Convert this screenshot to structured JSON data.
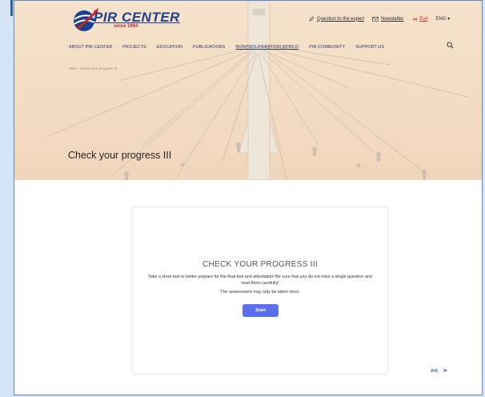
{
  "logo": {
    "text": "PIR CENTER",
    "since": "since 1994"
  },
  "topbar": {
    "expert": "Question to the expert",
    "newsletter": "Newsletter",
    "exit": "Exit",
    "lang": "ENG ▾"
  },
  "nav": [
    "ABOUT PIR CENTER",
    "PROJECTS",
    "EDUCATION",
    "PUBLICATIONS",
    "NONPROLIFERATION.WORLD",
    "PIR COMMUNITY",
    "SUPPORT US"
  ],
  "breadcrumb": "Main  •  Check your progress III",
  "page_title": "Check your progress III",
  "card": {
    "title": "CHECK YOUR PROGRESS III",
    "text": "Take a short test to better prepare for the final test and attestation! Be sure that you do not miss a single question and read them carefully!",
    "note": "The assessment may only be taken once.",
    "start_label": "Start"
  },
  "social": {
    "vk": "ᴡᴋ",
    "telegram": "➤"
  },
  "colors": {
    "accent": "#5a6ef0",
    "hero_bg": "#f3dcc3",
    "exit": "#d32f2f",
    "brand": "#1f3f8f"
  }
}
